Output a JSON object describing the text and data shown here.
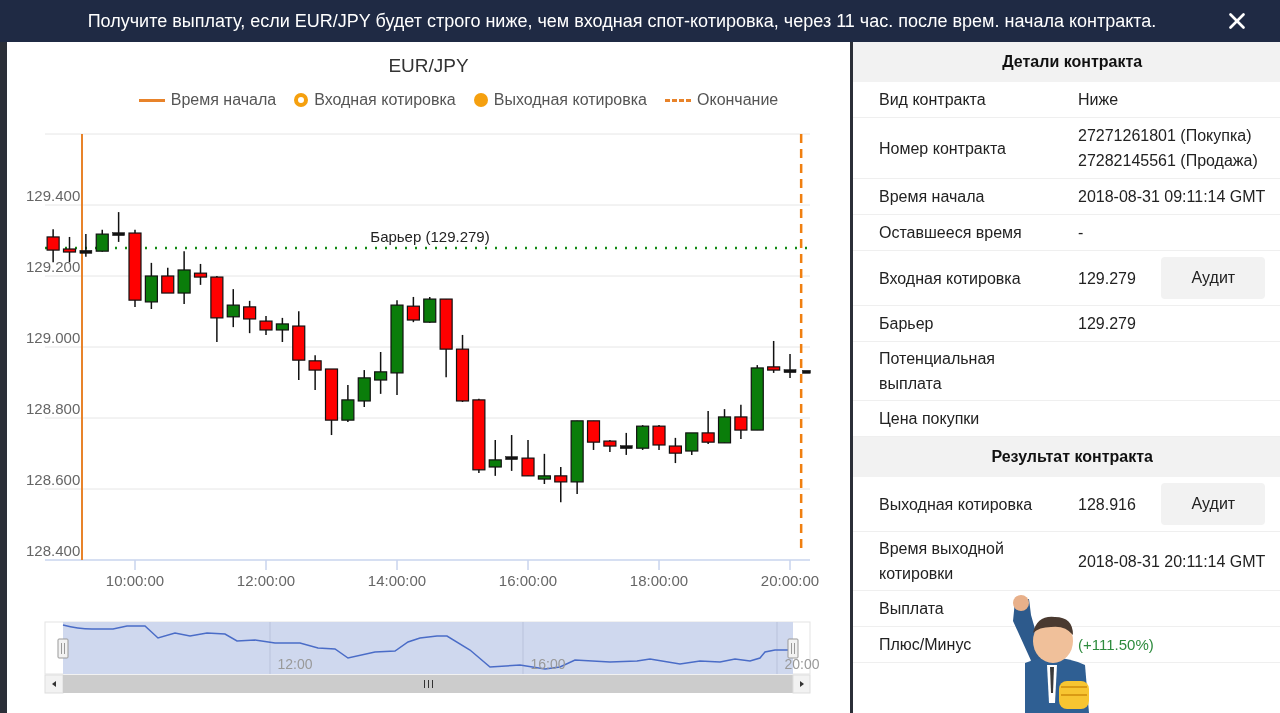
{
  "banner": {
    "text": "Получите выплату, если EUR/JPY будет строго ниже, чем входная спот-котировка, через 11 час. после врем. начала контракта."
  },
  "chart": {
    "legend": [
      {
        "kind": "solid-line",
        "label": "Время начала"
      },
      {
        "kind": "ring",
        "label": "Входная котировка"
      },
      {
        "kind": "dot",
        "label": "Выходная котировка"
      },
      {
        "kind": "dashed-line",
        "label": "Окончание"
      }
    ],
    "chart_data": {
      "type": "candlestick",
      "title": "EUR/JPY",
      "x": [
        8.75,
        9,
        9.25,
        9.5,
        9.75,
        10,
        10.25,
        10.5,
        10.75,
        11,
        11.25,
        11.5,
        11.75,
        12,
        12.25,
        12.5,
        12.75,
        13,
        13.25,
        13.5,
        13.75,
        14,
        14.25,
        14.5,
        14.75,
        15,
        15.25,
        15.5,
        15.75,
        16,
        16.25,
        16.5,
        16.75,
        17,
        17.25,
        17.5,
        17.75,
        18,
        18.25,
        18.5,
        18.75,
        19,
        19.25,
        19.5,
        19.75,
        20,
        20.25
      ],
      "ohlc": [
        [
          129.31,
          129.332,
          129.239,
          129.273
        ],
        [
          129.276,
          129.31,
          129.239,
          129.268
        ],
        [
          129.268,
          129.318,
          129.254,
          129.268
        ],
        [
          129.27,
          129.33,
          129.268,
          129.318
        ],
        [
          129.318,
          129.38,
          129.296,
          129.318
        ],
        [
          129.321,
          129.33,
          129.113,
          129.132
        ],
        [
          129.127,
          129.237,
          129.107,
          129.2
        ],
        [
          129.2,
          129.223,
          129.152,
          129.152
        ],
        [
          129.152,
          129.27,
          129.121,
          129.217
        ],
        [
          129.208,
          129.234,
          129.175,
          129.197
        ],
        [
          129.197,
          129.2,
          129.014,
          129.082
        ],
        [
          129.085,
          129.163,
          129.056,
          129.118
        ],
        [
          129.113,
          129.13,
          129.039,
          129.079
        ],
        [
          129.073,
          129.087,
          129.034,
          129.048
        ],
        [
          129.048,
          129.082,
          129.014,
          129.065
        ],
        [
          129.059,
          129.101,
          128.907,
          128.963
        ],
        [
          128.961,
          128.977,
          128.879,
          128.935
        ],
        [
          128.938,
          128.938,
          128.752,
          128.794
        ],
        [
          128.794,
          128.893,
          128.789,
          128.851
        ],
        [
          128.848,
          128.935,
          128.831,
          128.913
        ],
        [
          128.907,
          128.986,
          128.868,
          128.93
        ],
        [
          128.927,
          129.132,
          128.865,
          129.118
        ],
        [
          129.115,
          129.141,
          129.07,
          129.076
        ],
        [
          129.07,
          129.141,
          129.068,
          129.135
        ],
        [
          129.135,
          129.135,
          128.915,
          128.994
        ],
        [
          128.994,
          129.034,
          128.845,
          128.848
        ],
        [
          128.851,
          128.854,
          128.645,
          128.654
        ],
        [
          128.662,
          128.738,
          128.637,
          128.682
        ],
        [
          128.687,
          128.752,
          128.651,
          128.687
        ],
        [
          128.687,
          128.738,
          128.637,
          128.637
        ],
        [
          128.628,
          128.699,
          128.614,
          128.637
        ],
        [
          128.637,
          128.662,
          128.563,
          128.62
        ],
        [
          128.62,
          128.792,
          128.586,
          128.792
        ],
        [
          128.792,
          128.792,
          128.71,
          128.732
        ],
        [
          128.735,
          128.738,
          128.704,
          128.721
        ],
        [
          128.718,
          128.758,
          128.696,
          128.718
        ],
        [
          128.715,
          128.78,
          128.71,
          128.777
        ],
        [
          128.777,
          128.78,
          128.71,
          128.724
        ],
        [
          128.721,
          128.744,
          128.673,
          128.701
        ],
        [
          128.707,
          128.758,
          128.696,
          128.758
        ],
        [
          128.758,
          128.82,
          128.727,
          128.732
        ],
        [
          128.73,
          128.825,
          128.73,
          128.803
        ],
        [
          128.803,
          128.837,
          128.741,
          128.766
        ],
        [
          128.766,
          128.949,
          128.766,
          128.941
        ],
        [
          128.944,
          129.017,
          128.927,
          128.935
        ],
        [
          128.932,
          128.98,
          128.913,
          128.932
        ],
        [
          128.93,
          128.93,
          128.93,
          128.93
        ]
      ],
      "ylim": [
        128.4,
        129.6
      ],
      "grid": true,
      "yticks": [
        {
          "value": 129.4,
          "label": "129.400"
        },
        {
          "value": 129.2,
          "label": "129.200"
        },
        {
          "value": 129.0,
          "label": "129.000"
        },
        {
          "value": 128.8,
          "label": "128.800"
        },
        {
          "value": 128.6,
          "label": "128.600"
        },
        {
          "value": 128.4,
          "label": "128.400"
        }
      ],
      "xticks": [
        {
          "value": 10,
          "label": "10:00:00"
        },
        {
          "value": 12,
          "label": "12:00:00"
        },
        {
          "value": 14,
          "label": "14:00:00"
        },
        {
          "value": 16,
          "label": "16:00:00"
        },
        {
          "value": 18,
          "label": "18:00:00"
        },
        {
          "value": 20,
          "label": "20:00:00"
        }
      ],
      "xlim": [
        8.626,
        20.305
      ],
      "ref_lines": [
        {
          "axis": "y",
          "value": 129.279,
          "color": "#138a13",
          "label": "Барьер (129.279)"
        },
        {
          "axis": "x",
          "value": 20.17,
          "color": "#f07f10"
        }
      ]
    }
  },
  "navigator": {
    "labels": [
      "12:00",
      "16:00",
      "20:00"
    ]
  },
  "details": {
    "title": "Детали контракта",
    "rows": [
      {
        "kind": "text",
        "label": "Вид контракта",
        "values": [
          "Ниже"
        ]
      },
      {
        "kind": "text",
        "label": "Номер контракта",
        "values": [
          "27271261801 (Покупка)",
          "27282145561 (Продажа)"
        ]
      },
      {
        "kind": "text",
        "label": "Время начала",
        "values": [
          "2018-08-31 09:11:14 GMT"
        ]
      },
      {
        "kind": "text",
        "label": "Оставшееся время",
        "values": [
          "-"
        ]
      },
      {
        "kind": "text",
        "label": "Входная котировка",
        "values": [
          "129.279"
        ],
        "button": "Аудит"
      },
      {
        "kind": "text",
        "label": "Барьер",
        "values": [
          "129.279"
        ]
      },
      {
        "label": "Потенциальная выплата"
      },
      {
        "label": "Цена покупки"
      }
    ]
  },
  "result": {
    "title": "Результат контракта",
    "rows": [
      {
        "kind": "text",
        "label": "Выходная котировка",
        "values": [
          "128.916"
        ],
        "button": "Аудит"
      },
      {
        "kind": "text",
        "label": "Время выходной котировки",
        "values": [
          "2018-08-31 20:11:14 GMT"
        ]
      },
      {
        "label": "Выплата"
      },
      {
        "kind": "profit",
        "label": "Плюс/Минус",
        "values": [
          "(+111.50%)"
        ]
      }
    ]
  }
}
